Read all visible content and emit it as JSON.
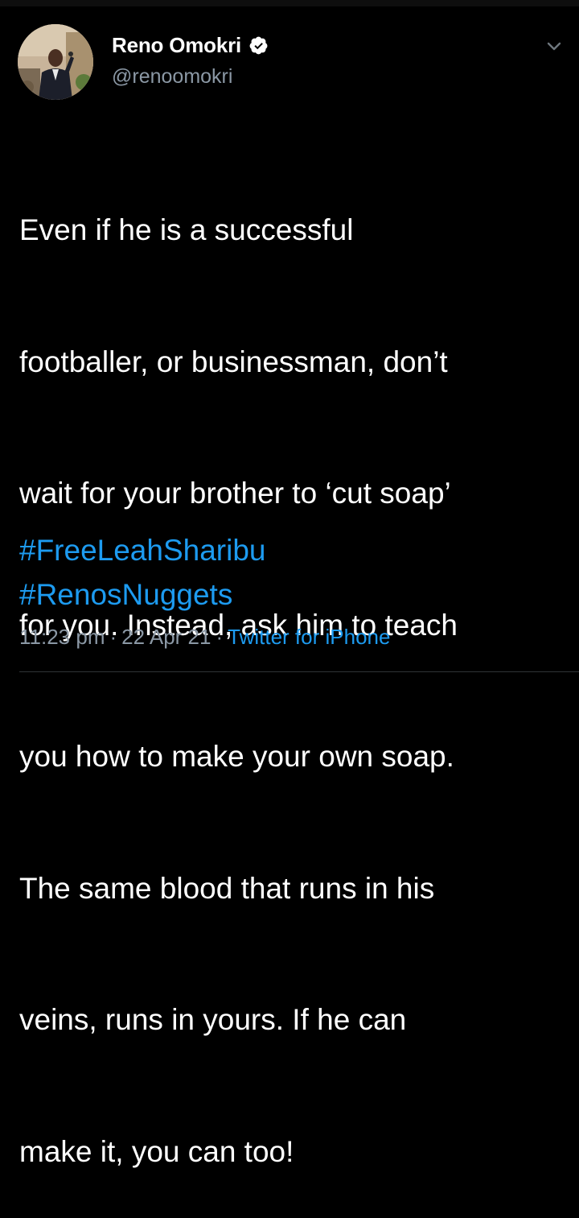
{
  "user": {
    "display_name": "Reno Omokri",
    "handle": "@renoomokri",
    "verified": true
  },
  "tweet": {
    "lines": [
      "Even if he is a successful",
      "footballer, or businessman, don’t",
      "wait for your brother to ‘cut soap’",
      "for you. Instead, ask him to teach",
      "you how to make your own soap.",
      "The same blood that runs in his",
      "veins, runs in yours. If he can",
      "make it, you can too!"
    ],
    "hashtags": [
      "#FreeLeahSharibu",
      "#RenosNuggets"
    ]
  },
  "meta": {
    "time": "11:23 pm",
    "separator": "·",
    "date": "22 Apr 21",
    "source": "Twitter for iPhone"
  },
  "icons": {
    "verified": "verified-badge-icon",
    "more": "chevron-down-icon"
  },
  "colors": {
    "background": "#000000",
    "text": "#ffffff",
    "secondary": "#8b98a5",
    "accent": "#1d9bf0"
  }
}
